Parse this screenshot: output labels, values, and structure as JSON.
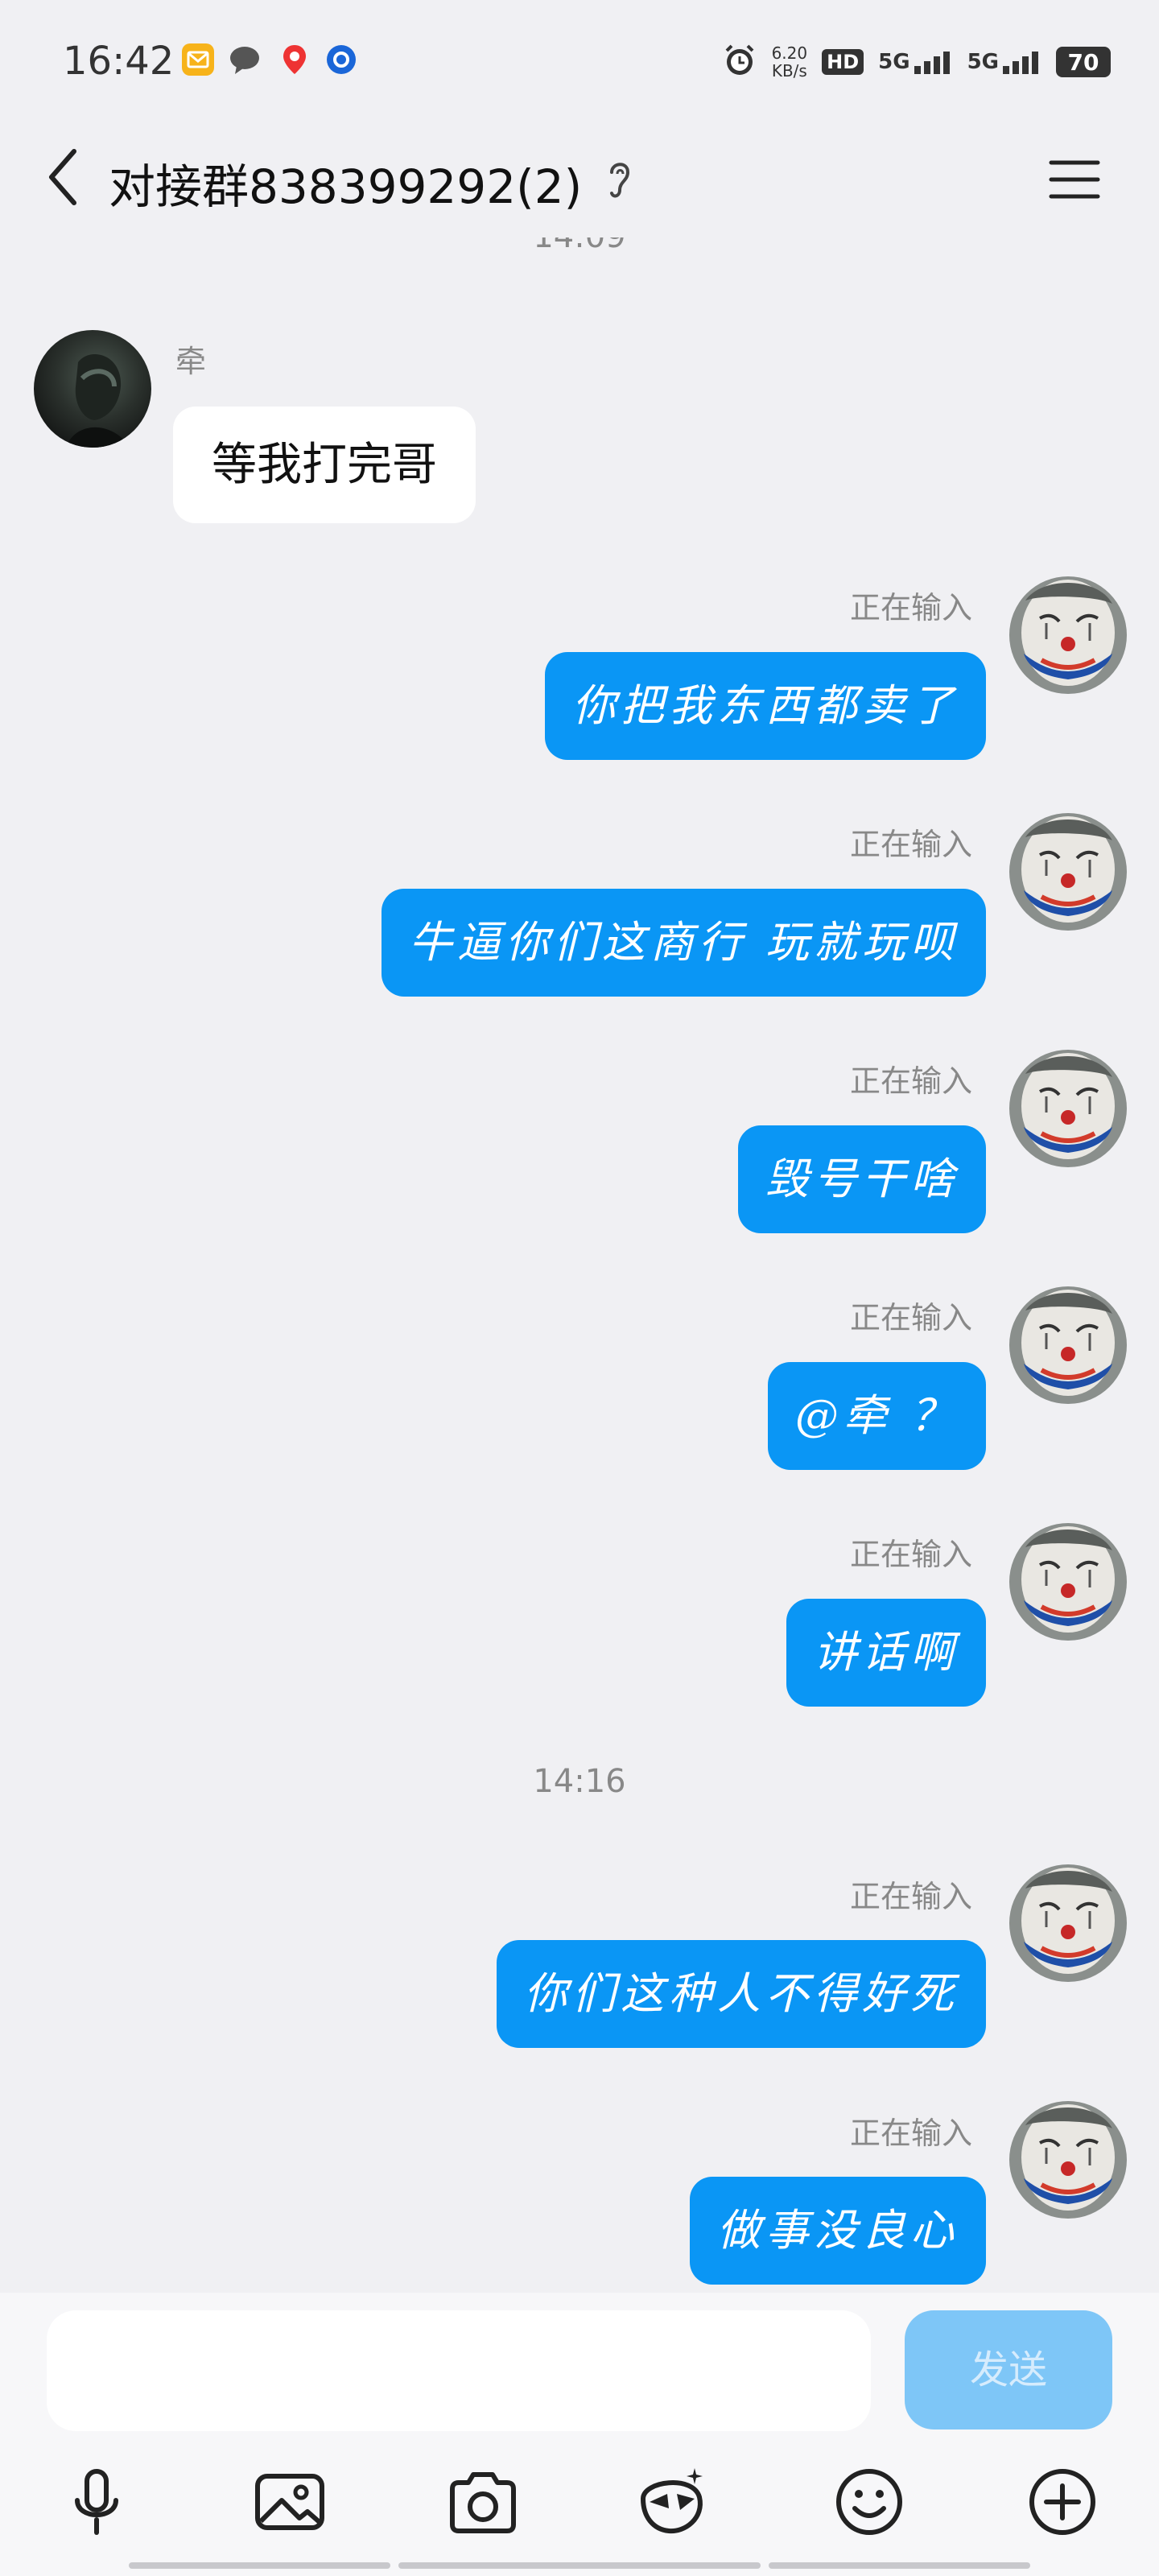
{
  "status_bar": {
    "time": "16:42",
    "speed_value": "6.20",
    "speed_unit": "KB/s",
    "hd_label": "HD",
    "net1": "5G",
    "net2": "5G",
    "battery": "70"
  },
  "header": {
    "title": "对接群838399292(2)"
  },
  "messages": {
    "top_timestamp": "14:09",
    "other_name": "牵",
    "other_text": "等我打完哥",
    "typing_status": "正在输入",
    "m1": "你把我东西都卖了",
    "m2": "牛逼你们这商行 玩就玩呗",
    "m3": "毁号干啥",
    "m4": "@牵 ？",
    "m5": "讲话啊",
    "timestamp_2": "14:16",
    "m6": "你们这种人不得好死",
    "m7": "做事没良心"
  },
  "input": {
    "send_label": "发送"
  },
  "icons": {
    "back": "chevron-left-icon",
    "ear": "ear-icon",
    "menu": "hamburger-menu-icon",
    "tools": [
      "microphone-icon",
      "image-icon",
      "camera-icon",
      "fun-mask-icon",
      "emoji-icon",
      "plus-icon"
    ]
  },
  "colors": {
    "accent": "#0a96f5",
    "background": "#f0f0f3",
    "send_disabled": "#7ec6f7"
  }
}
